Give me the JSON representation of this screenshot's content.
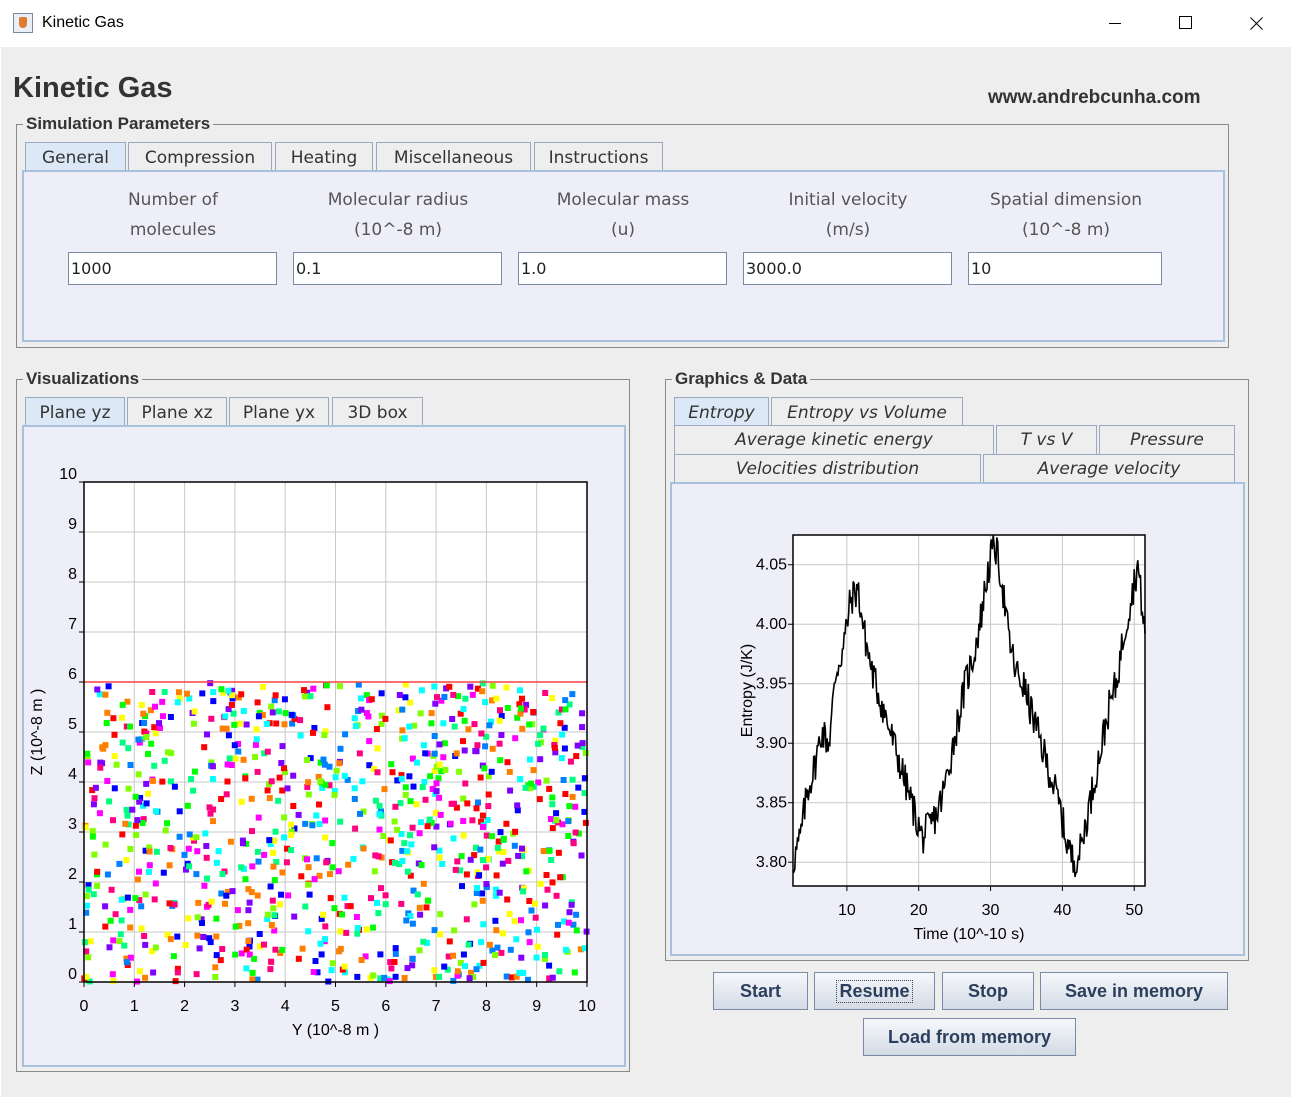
{
  "window": {
    "title": "Kinetic Gas"
  },
  "header": {
    "title": "Kinetic Gas",
    "website": "www.andrebcunha.com"
  },
  "sim_params": {
    "title": "Simulation Parameters",
    "tabs": [
      "General",
      "Compression",
      "Heating",
      "Miscellaneous",
      "Instructions"
    ],
    "active_tab": "General",
    "fields": [
      {
        "label_line1": "Number of",
        "label_line2": "molecules",
        "value": "1000"
      },
      {
        "label_line1": "Molecular radius",
        "label_line2": "(10^-8 m)",
        "value": "0.1"
      },
      {
        "label_line1": "Molecular mass",
        "label_line2": "(u)",
        "value": "1.0"
      },
      {
        "label_line1": "Initial velocity",
        "label_line2": "(m/s)",
        "value": "3000.0"
      },
      {
        "label_line1": "Spatial dimension",
        "label_line2": "(10^-8 m)",
        "value": "10"
      }
    ]
  },
  "visualizations": {
    "title": "Visualizations",
    "tabs": [
      "Plane yz",
      "Plane xz",
      "Plane yx",
      "3D box"
    ],
    "active_tab": "Plane yz"
  },
  "graphics": {
    "title": "Graphics & Data",
    "tabs_row1": [
      "Entropy",
      "Entropy vs Volume"
    ],
    "tabs_row2": [
      "Average kinetic energy",
      "T vs V",
      "Pressure"
    ],
    "tabs_row3": [
      "Velocities distribution",
      "Average velocity"
    ],
    "active_tab": "Entropy"
  },
  "buttons": {
    "start": "Start",
    "resume": "Resume",
    "stop": "Stop",
    "save": "Save in memory",
    "load": "Load from memory"
  },
  "colors": {
    "piston": "#ff4040",
    "molecule_palette": [
      "#ff0000",
      "#ff8000",
      "#ffff00",
      "#80ff00",
      "#00ff00",
      "#00ff80",
      "#00ffff",
      "#0080ff",
      "#0000ff",
      "#8000ff",
      "#ff00ff",
      "#ff0080"
    ]
  },
  "chart_data": [
    {
      "type": "scatter",
      "title": "",
      "xlabel": "Y (10^-8 m )",
      "ylabel": "Z (10^-8 m )",
      "xlim": [
        0,
        10
      ],
      "ylim": [
        0,
        10
      ],
      "x_ticks": [
        "0",
        "1",
        "2",
        "3",
        "4",
        "5",
        "6",
        "7",
        "8",
        "9",
        "10"
      ],
      "y_ticks": [
        "0",
        "1",
        "2",
        "3",
        "4",
        "5",
        "6",
        "7",
        "8",
        "9",
        "10"
      ],
      "grid": true,
      "piston_z": 6.0,
      "molecule_count": 1000
    },
    {
      "type": "line",
      "title": "",
      "xlabel": "Time (10^-10 s)",
      "ylabel": "Entropy (J/K)",
      "xlim": [
        2.5,
        51.5
      ],
      "ylim": [
        3.78,
        4.075
      ],
      "x_ticks": [
        "10",
        "20",
        "30",
        "40",
        "50"
      ],
      "y_ticks": [
        "3.80",
        "3.85",
        "3.90",
        "3.95",
        "4.00",
        "4.05"
      ],
      "grid": true,
      "x": [
        2.5,
        3.5,
        4.5,
        5.5,
        6.5,
        7.5,
        8.5,
        9.5,
        10.5,
        11.5,
        12.5,
        13.5,
        14.5,
        15.5,
        16.5,
        17.5,
        18.5,
        19.5,
        20.5,
        21.5,
        22.5,
        23.5,
        24.5,
        25.5,
        26.5,
        27.5,
        28.5,
        29.5,
        30.5,
        31.5,
        32.5,
        33.5,
        34.5,
        35.5,
        36.5,
        37.5,
        38.5,
        39.5,
        40.5,
        41.5,
        42.5,
        43.5,
        44.5,
        45.5,
        46.5,
        47.5,
        48.5,
        49.5,
        50.5,
        51.5
      ],
      "y": [
        3.8,
        3.82,
        3.86,
        3.88,
        3.91,
        3.9,
        3.96,
        3.98,
        4.02,
        4.03,
        3.99,
        3.96,
        3.94,
        3.92,
        3.9,
        3.88,
        3.86,
        3.84,
        3.82,
        3.83,
        3.84,
        3.86,
        3.89,
        3.92,
        3.95,
        3.97,
        4.0,
        4.04,
        4.07,
        4.04,
        3.99,
        3.96,
        3.95,
        3.93,
        3.91,
        3.89,
        3.87,
        3.85,
        3.82,
        3.8,
        3.81,
        3.84,
        3.87,
        3.9,
        3.93,
        3.95,
        3.99,
        4.02,
        4.05,
        3.99
      ]
    }
  ]
}
